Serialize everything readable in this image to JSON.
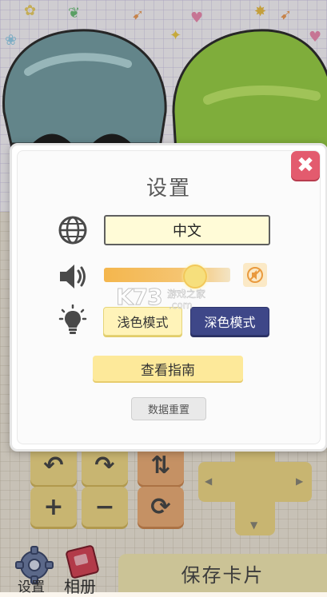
{
  "dialog": {
    "title": "设置",
    "close_symbol": "✖",
    "language_value": "中文",
    "volume_level": 0.72,
    "light_mode_label": "浅色模式",
    "dark_mode_label": "深色模式",
    "guide_label": "查看指南",
    "reset_label": "数据重置"
  },
  "watermark": {
    "main": "K73",
    "sub": "游戏之家",
    "domain": ".com"
  },
  "bottom_bar": {
    "settings_label": "设置",
    "album_label": "相册",
    "save_card_label": "保存卡片"
  },
  "controls": [
    "↶",
    "↷",
    "⇅",
    "+",
    "−",
    "⟳"
  ],
  "icons": [
    "globe-icon",
    "speaker-icon",
    "bulb-icon",
    "mute-icon",
    "close-icon",
    "gear-icon",
    "album-icon"
  ],
  "colors": {
    "accent_dark": "#3e4788",
    "close_red": "#e35b6e",
    "field_yellow": "#fffbd7",
    "slider_orange": "#f4b64d"
  }
}
